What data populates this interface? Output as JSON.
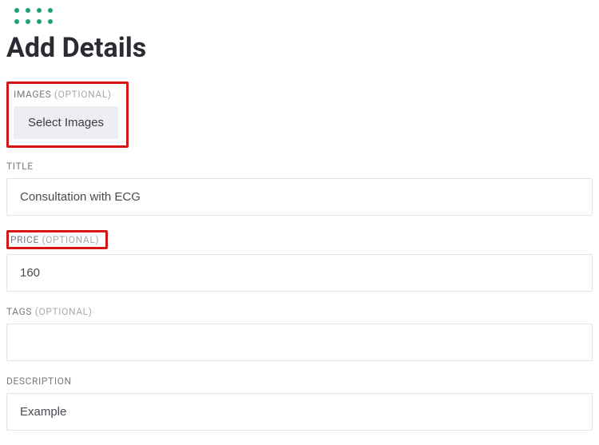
{
  "header": {
    "title": "Add Details"
  },
  "fields": {
    "images": {
      "label": "IMAGES",
      "optional": "(OPTIONAL)",
      "button_label": "Select Images"
    },
    "title": {
      "label": "TITLE",
      "value": "Consultation with ECG"
    },
    "price": {
      "label": "PRICE",
      "optional": "(OPTIONAL)",
      "value": "160"
    },
    "tags": {
      "label": "TAGS",
      "optional": "(OPTIONAL)",
      "value": ""
    },
    "description": {
      "label": "DESCRIPTION",
      "value": "Example"
    }
  }
}
